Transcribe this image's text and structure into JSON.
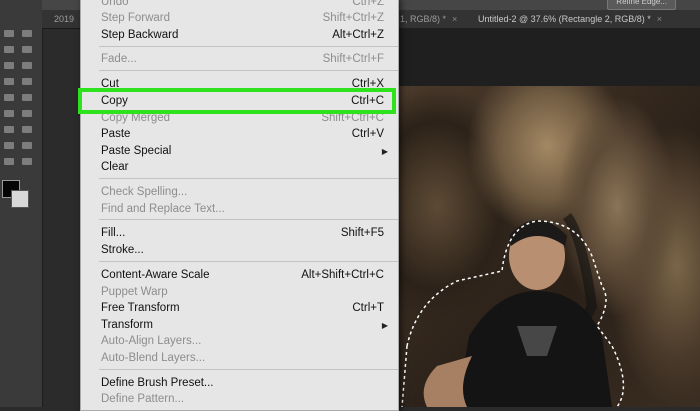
{
  "tabs": [
    {
      "label": "2019"
    },
    {
      "label": "1, RGB/8) *",
      "close": "×"
    },
    {
      "label": "Untitled-2 @ 37.6% (Rectangle 2, RGB/8) *",
      "close": "×"
    }
  ],
  "options_bar": {
    "refine_edge_label": "Refine Edge..."
  },
  "edit_menu": {
    "items": [
      {
        "label": "Undo",
        "shortcut": "Ctrl+Z"
      },
      {
        "label": "Step Forward",
        "shortcut": "Shift+Ctrl+Z"
      },
      {
        "label": "Step Backward",
        "shortcut": "Alt+Ctrl+Z"
      },
      {
        "label": "Fade...",
        "shortcut": "Shift+Ctrl+F"
      },
      {
        "label": "Cut",
        "shortcut": "Ctrl+X"
      },
      {
        "label": "Copy",
        "shortcut": "Ctrl+C"
      },
      {
        "label": "Copy Merged",
        "shortcut": "Shift+Ctrl+C"
      },
      {
        "label": "Paste",
        "shortcut": "Ctrl+V"
      },
      {
        "label": "Paste Special",
        "submenu": "▶"
      },
      {
        "label": "Clear"
      },
      {
        "label": "Check Spelling..."
      },
      {
        "label": "Find and Replace Text..."
      },
      {
        "label": "Fill...",
        "shortcut": "Shift+F5"
      },
      {
        "label": "Stroke..."
      },
      {
        "label": "Content-Aware Scale",
        "shortcut": "Alt+Shift+Ctrl+C"
      },
      {
        "label": "Puppet Warp"
      },
      {
        "label": "Free Transform",
        "shortcut": "Ctrl+T"
      },
      {
        "label": "Transform",
        "submenu": "▶"
      },
      {
        "label": "Auto-Align Layers..."
      },
      {
        "label": "Auto-Blend Layers..."
      },
      {
        "label": "Define Brush Preset..."
      },
      {
        "label": "Define Pattern..."
      }
    ]
  },
  "highlight_color": "#2ee21d"
}
